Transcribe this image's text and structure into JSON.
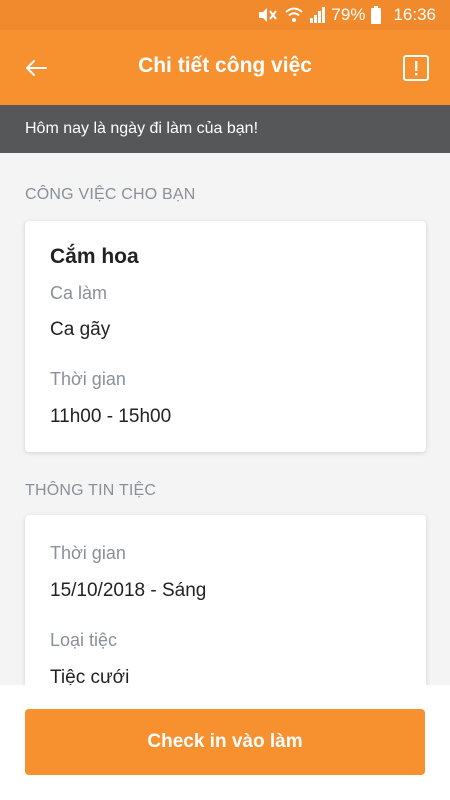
{
  "status_bar": {
    "battery": "79%",
    "time": "16:36"
  },
  "app_bar": {
    "title": "Chi tiết công việc"
  },
  "notice": "Hôm nay là ngày đi làm của bạn!",
  "job_section": {
    "title": "CÔNG VIỆC CHO BẠN",
    "job_name": "Cắm hoa",
    "shift_label": "Ca làm",
    "shift_value": "Ca gãy",
    "time_label": "Thời gian",
    "time_value": "11h00 - 15h00"
  },
  "party_section": {
    "title": "THÔNG TIN TIỆC",
    "time_label": "Thời gian",
    "time_value": "15/10/2018 - Sáng",
    "type_label": "Loại tiệc",
    "type_value": "Tiệc cưới"
  },
  "checkin_button": "Check in vào làm",
  "colors": {
    "primary": "#f7902f",
    "notice_bg": "#555759",
    "muted_text": "#8a8f98"
  }
}
